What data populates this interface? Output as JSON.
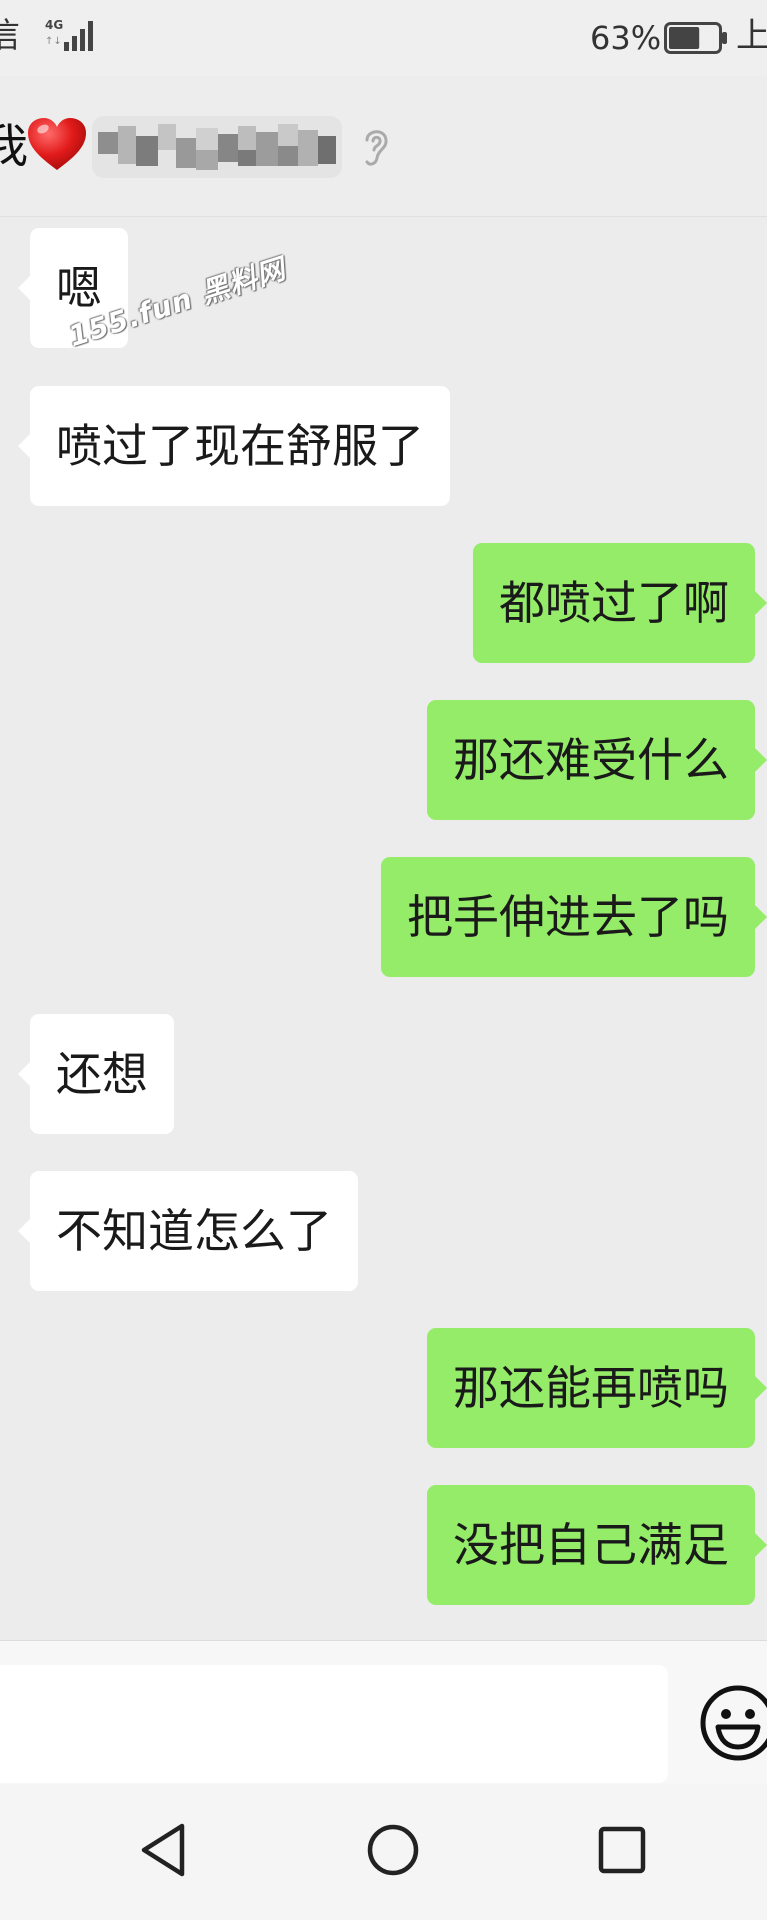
{
  "status_bar": {
    "carrier": "信",
    "network_type": "4G",
    "network_arrows": "↑↓",
    "signal_icon": "signal-icon",
    "battery_percent": "63%",
    "battery_level": 0.63,
    "battery_icon": "battery-icon",
    "clock": "上"
  },
  "chat_header": {
    "title": "我",
    "heart_emoji": "heart-emoji",
    "contact_name_blurred": true,
    "earpiece_icon": "ear-icon"
  },
  "watermark": "155.fun 黑料网",
  "messages": [
    {
      "side": "incoming",
      "text": "嗯"
    },
    {
      "side": "incoming",
      "text": "喷过了现在舒服了"
    },
    {
      "side": "outgoing",
      "text": "都喷过了啊"
    },
    {
      "side": "outgoing",
      "text": "那还难受什么"
    },
    {
      "side": "outgoing",
      "text": "把手伸进去了吗"
    },
    {
      "side": "incoming",
      "text": "还想"
    },
    {
      "side": "incoming",
      "text": "不知道怎么了"
    },
    {
      "side": "outgoing",
      "text": "那还能再喷吗"
    },
    {
      "side": "outgoing",
      "text": "没把自己满足"
    }
  ],
  "input_bar": {
    "value": "",
    "emoji_icon": "emoji-icon"
  },
  "nav_bar": {
    "back_icon": "back-icon",
    "home_icon": "home-icon",
    "recents_icon": "recents-icon"
  },
  "colors": {
    "background": "#ececec",
    "incoming_bubble": "#ffffff",
    "outgoing_bubble": "#95ec69",
    "text": "#1a1a1a"
  }
}
